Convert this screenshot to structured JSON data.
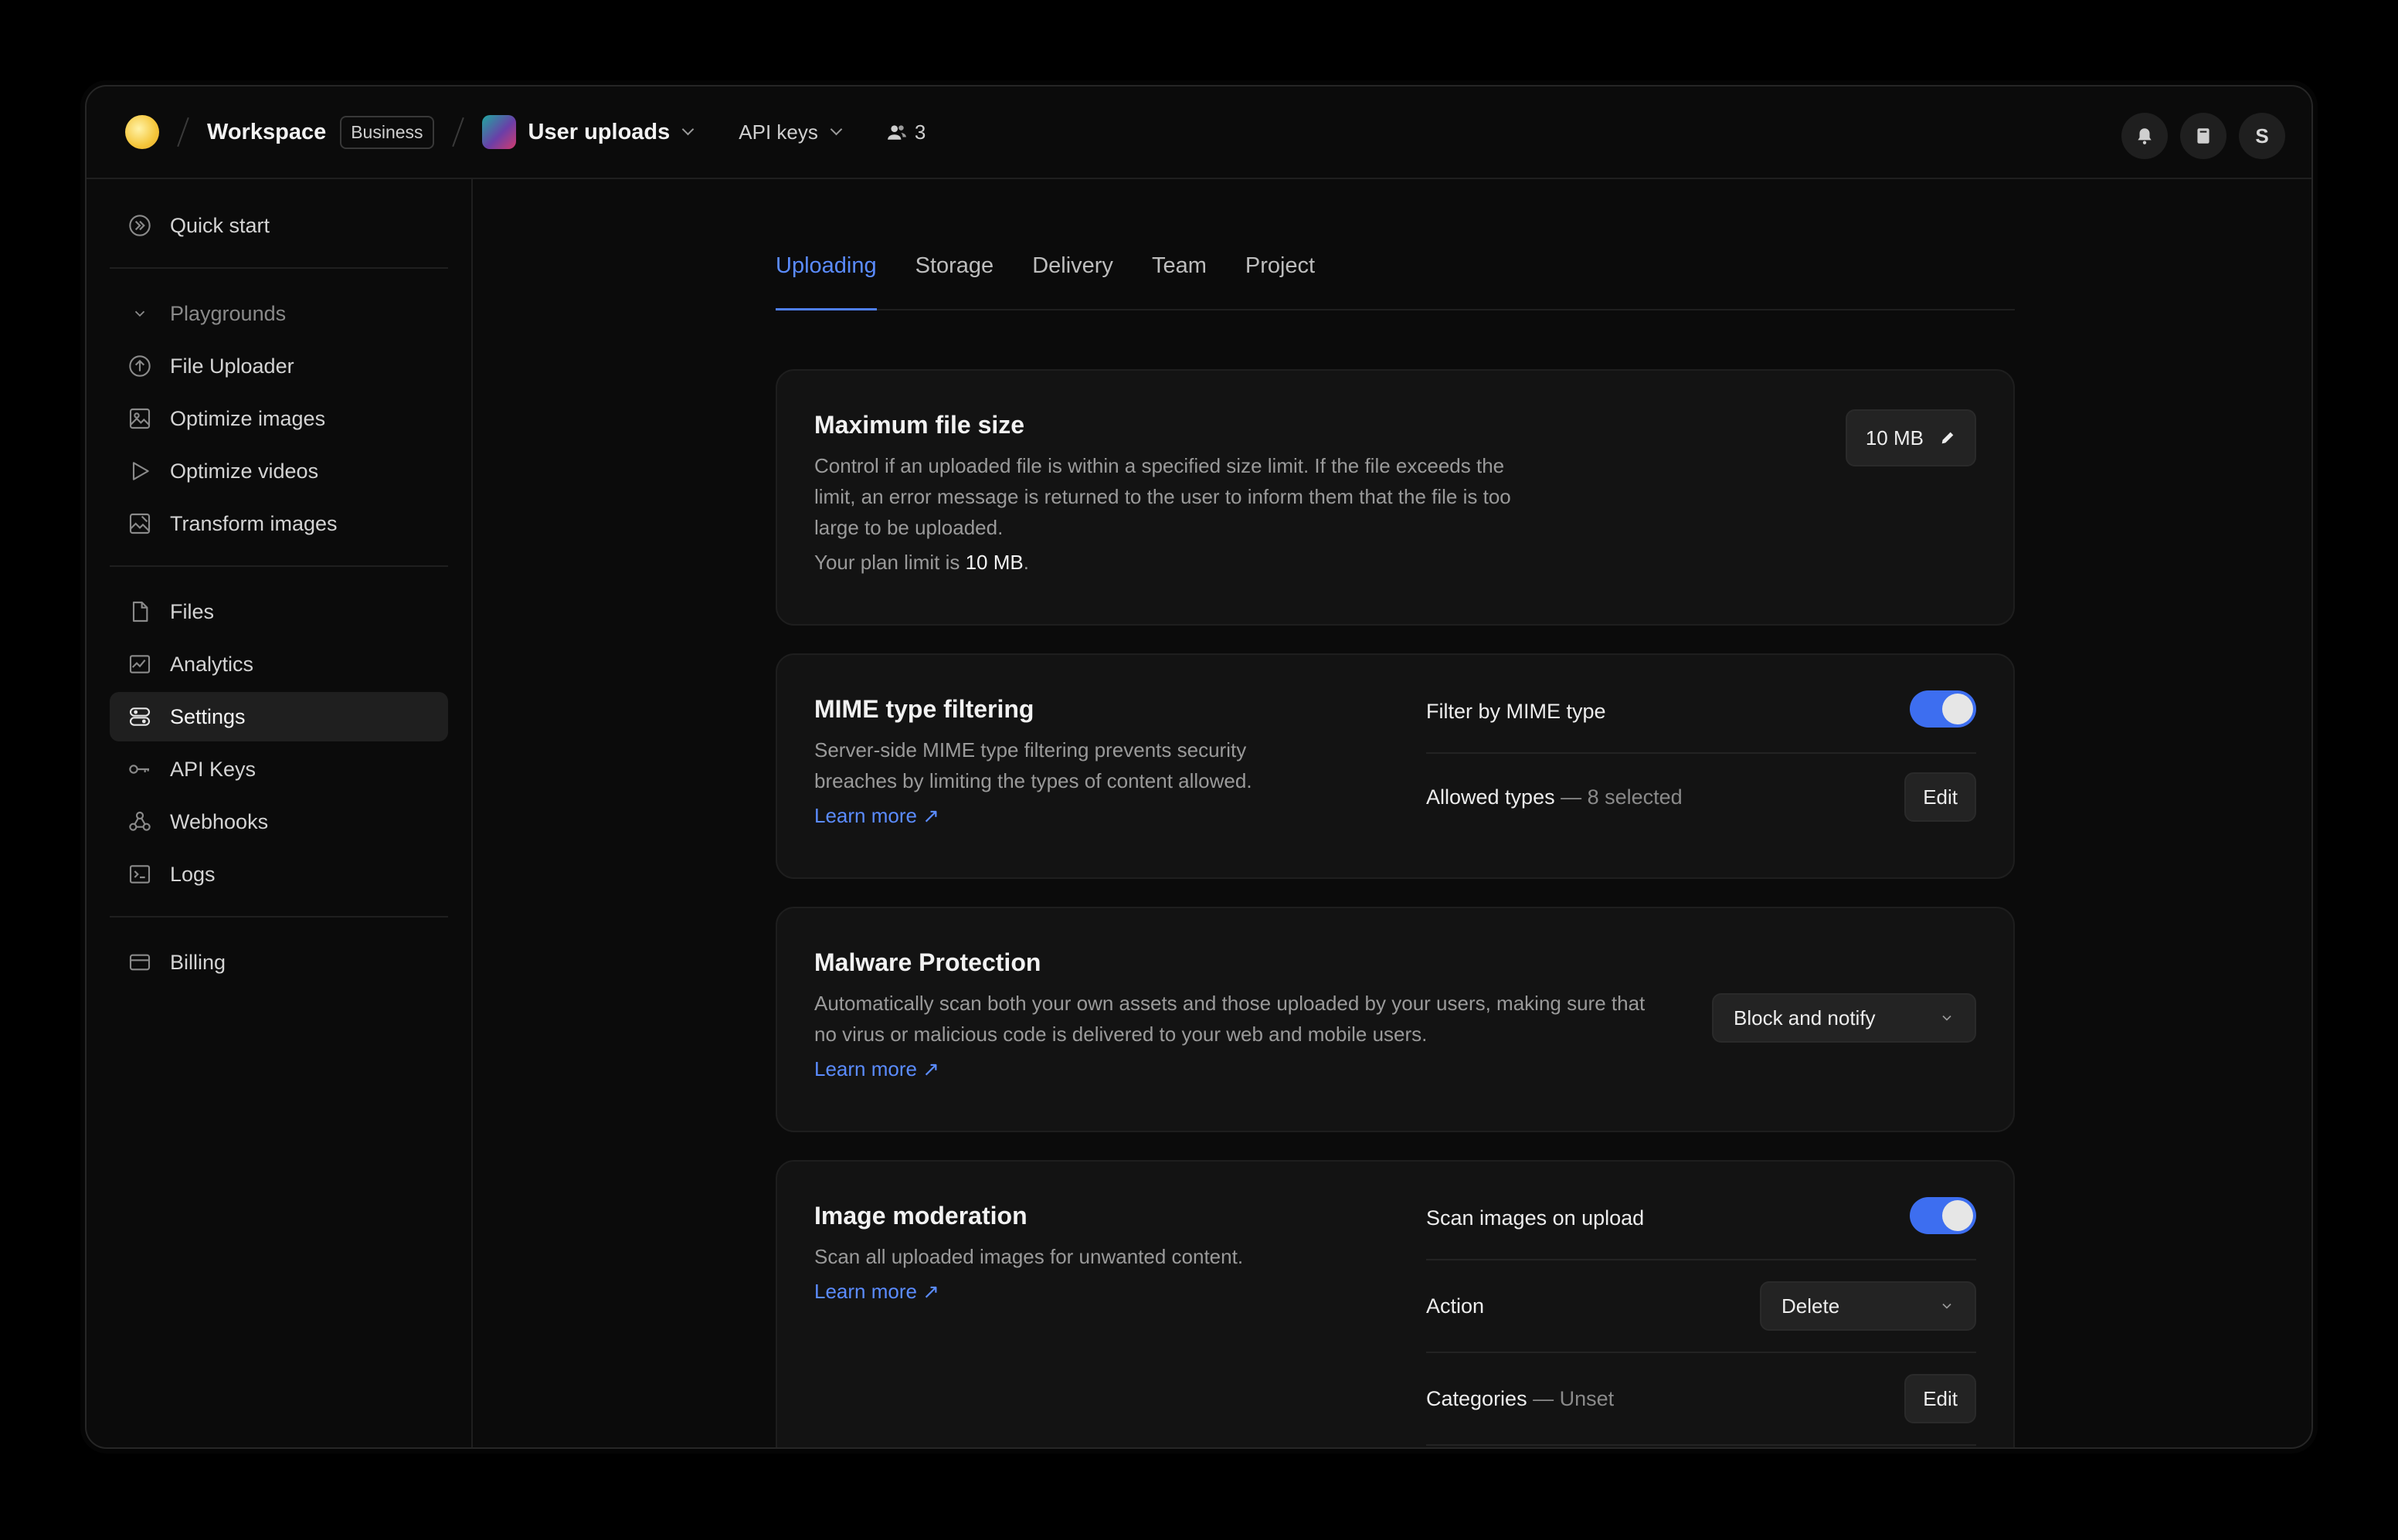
{
  "topbar": {
    "workspace_name": "Workspace",
    "plan_badge": "Business",
    "project_name": "User uploads",
    "api_menu_label": "API keys",
    "members_count": "3",
    "avatar_initial": "S"
  },
  "sidebar": {
    "quick_start": "Quick start",
    "playgrounds_label": "Playgrounds",
    "playgrounds": [
      "File Uploader",
      "Optimize images",
      "Optimize videos",
      "Transform images"
    ],
    "main_items": [
      "Files",
      "Analytics",
      "Settings",
      "API Keys",
      "Webhooks",
      "Logs"
    ],
    "active_item": "Settings",
    "billing": "Billing"
  },
  "tabs": [
    "Uploading",
    "Storage",
    "Delivery",
    "Team",
    "Project"
  ],
  "active_tab": "Uploading",
  "max_file_size": {
    "title": "Maximum file size",
    "description": "Control if an uploaded file is within a specified size limit. If the file exceeds the limit, an error message is returned to the user to inform them that the file is too large to be uploaded.",
    "plan_limit_prefix": "Your plan limit is",
    "plan_limit_value": "10 MB",
    "plan_limit_suffix": ".",
    "button_value": "10 MB"
  },
  "mime": {
    "title": "MIME type filtering",
    "description": "Server-side MIME type filtering prevents security breaches by limiting the types of content allowed.",
    "learn_more": "Learn more",
    "filter_label": "Filter by MIME type",
    "filter_enabled": true,
    "allowed_label": "Allowed types",
    "allowed_value": "— 8 selected",
    "edit_label": "Edit"
  },
  "malware": {
    "title": "Malware Protection",
    "description": "Automatically scan both your own assets and those uploaded by your users, making sure that no virus or malicious code is delivered to your web and mobile users.",
    "learn_more": "Learn more",
    "select_value": "Block and notify"
  },
  "moderation": {
    "title": "Image moderation",
    "description": "Scan all uploaded images for unwanted content.",
    "learn_more": "Learn more",
    "scan_label": "Scan images on upload",
    "scan_enabled": true,
    "action_label": "Action",
    "action_value": "Delete",
    "categories_label": "Categories",
    "categories_value": "— Unset",
    "edit_label": "Edit"
  },
  "colors": {
    "accent": "#5b8cff",
    "toggle_on": "#3d6ef0",
    "background": "#0b0b0b",
    "card": "#131313"
  }
}
